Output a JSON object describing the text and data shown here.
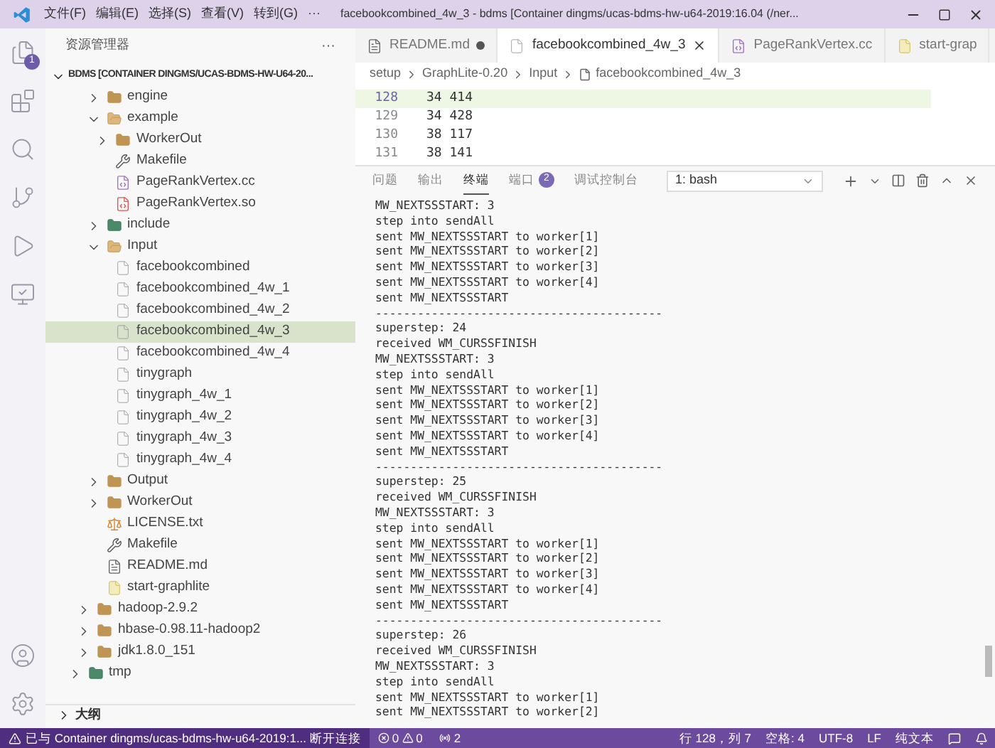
{
  "window": {
    "title": "facebookcombined_4w_3 - bdms [Container dingms/ucas-bdms-hw-u64-2019:16.04 (/ner...",
    "menu": [
      "文件(F)",
      "编辑(E)",
      "选择(S)",
      "查看(V)",
      "转到(G)",
      "···"
    ]
  },
  "activity_bar": {
    "explorer_badge": "1"
  },
  "sidebar": {
    "title": "资源管理器",
    "more": "···",
    "tree": [
      {
        "label": "BDMS [CONTAINER DINGMS/UCAS-BDMS-HW-U64-20...",
        "kind": "root",
        "expanded": true,
        "selected": false,
        "children": [
          {
            "children": [
              {
                "children": [
                  {
                    "label": "engine",
                    "kind": "folder",
                    "expanded": false,
                    "selected": false
                  },
                  {
                    "label": "example",
                    "kind": "folder",
                    "expanded": true,
                    "selected": false,
                    "children": [
                      {
                        "label": "WorkerOut",
                        "kind": "folder",
                        "expanded": false,
                        "selected": false
                      },
                      {
                        "label": "Makefile",
                        "kind": "makefile",
                        "selected": false
                      },
                      {
                        "label": "PageRankVertex.cc",
                        "kind": "cpp",
                        "selected": false
                      },
                      {
                        "label": "PageRankVertex.so",
                        "kind": "binary",
                        "selected": false
                      }
                    ]
                  },
                  {
                    "label": "include",
                    "kind": "special-folder",
                    "expanded": false,
                    "selected": false
                  },
                  {
                    "label": "Input",
                    "kind": "folder",
                    "expanded": true,
                    "selected": false,
                    "children": [
                      {
                        "label": "facebookcombined",
                        "kind": "file",
                        "selected": false
                      },
                      {
                        "label": "facebookcombined_4w_1",
                        "kind": "file",
                        "selected": false
                      },
                      {
                        "label": "facebookcombined_4w_2",
                        "kind": "file",
                        "selected": false
                      },
                      {
                        "label": "facebookcombined_4w_3",
                        "kind": "file",
                        "selected": true
                      },
                      {
                        "label": "facebookcombined_4w_4",
                        "kind": "file",
                        "selected": false
                      },
                      {
                        "label": "tinygraph",
                        "kind": "file",
                        "selected": false
                      },
                      {
                        "label": "tinygraph_4w_1",
                        "kind": "file",
                        "selected": false
                      },
                      {
                        "label": "tinygraph_4w_2",
                        "kind": "file",
                        "selected": false
                      },
                      {
                        "label": "tinygraph_4w_3",
                        "kind": "file",
                        "selected": false
                      },
                      {
                        "label": "tinygraph_4w_4",
                        "kind": "file",
                        "selected": false
                      }
                    ]
                  },
                  {
                    "label": "Output",
                    "kind": "folder",
                    "expanded": false,
                    "selected": false
                  },
                  {
                    "label": "WorkerOut",
                    "kind": "folder",
                    "expanded": false,
                    "selected": false
                  },
                  {
                    "label": "LICENSE.txt",
                    "kind": "license",
                    "selected": false
                  },
                  {
                    "label": "Makefile",
                    "kind": "makefile",
                    "selected": false
                  },
                  {
                    "label": "README.md",
                    "kind": "markdown",
                    "selected": false
                  },
                  {
                    "label": "start-graphlite",
                    "kind": "script",
                    "selected": false
                  }
                ]
              },
              {
                "label": "hadoop-2.9.2",
                "kind": "folder",
                "expanded": false,
                "selected": false
              },
              {
                "label": "hbase-0.98.11-hadoop2",
                "kind": "folder",
                "expanded": false,
                "selected": false
              },
              {
                "label": "jdk1.8.0_151",
                "kind": "folder",
                "expanded": false,
                "selected": false
              }
            ]
          },
          {
            "label": "tmp",
            "kind": "special-folder",
            "expanded": false,
            "selected": false
          }
        ]
      }
    ],
    "outline": {
      "label": "大纲",
      "expanded": false
    }
  },
  "tabs": [
    {
      "label": "README.md",
      "kind": "markdown",
      "selected": false,
      "modified": true
    },
    {
      "label": "facebookcombined_4w_3",
      "kind": "file",
      "selected": true,
      "modified": false
    },
    {
      "label": "PageRankVertex.cc",
      "kind": "cpp",
      "selected": false,
      "modified": false
    },
    {
      "label": "start-grap",
      "kind": "script",
      "selected": false,
      "modified": false
    }
  ],
  "breadcrumb": [
    "setup",
    "GraphLite-0.20",
    "Input",
    "facebookcombined_4w_3"
  ],
  "editor": {
    "lines": [
      {
        "number": "128",
        "text": "34 414",
        "current": true
      },
      {
        "number": "129",
        "text": "34 428",
        "current": false
      },
      {
        "number": "130",
        "text": "38 117",
        "current": false
      },
      {
        "number": "131",
        "text": "38 141",
        "current": false
      }
    ]
  },
  "panel": {
    "tabs": [
      {
        "label": "问题",
        "selected": false
      },
      {
        "label": "输出",
        "selected": false
      },
      {
        "label": "终端",
        "selected": true
      },
      {
        "label": "端口",
        "selected": false,
        "badge": "2"
      },
      {
        "label": "调试控制台",
        "selected": false
      }
    ],
    "terminal_select": "1: bash",
    "terminal": [
      "MW_NEXTSSSTART: 3",
      "step into sendAll",
      "sent MW_NEXTSSSTART to worker[1]",
      "sent MW_NEXTSSSTART to worker[2]",
      "sent MW_NEXTSSSTART to worker[3]",
      "sent MW_NEXTSSSTART to worker[4]",
      "sent MW_NEXTSSSTART",
      "-----------------------------------------",
      "superstep: 24",
      "received WM_CURSSFINISH",
      "MW_NEXTSSSTART: 3",
      "step into sendAll",
      "sent MW_NEXTSSSTART to worker[1]",
      "sent MW_NEXTSSSTART to worker[2]",
      "sent MW_NEXTSSSTART to worker[3]",
      "sent MW_NEXTSSSTART to worker[4]",
      "sent MW_NEXTSSSTART",
      "-----------------------------------------",
      "superstep: 25",
      "received WM_CURSSFINISH",
      "MW_NEXTSSSTART: 3",
      "step into sendAll",
      "sent MW_NEXTSSSTART to worker[1]",
      "sent MW_NEXTSSSTART to worker[2]",
      "sent MW_NEXTSSSTART to worker[3]",
      "sent MW_NEXTSSSTART to worker[4]",
      "sent MW_NEXTSSSTART",
      "-----------------------------------------",
      "superstep: 26",
      "received WM_CURSSFINISH",
      "MW_NEXTSSSTART: 3",
      "step into sendAll",
      "sent MW_NEXTSSSTART to worker[1]",
      "sent MW_NEXTSSSTART to worker[2]"
    ]
  },
  "status_bar": {
    "remote": "已与 Container dingms/ucas-bdms-hw-u64-2019:1... 断开连接",
    "errors": "0",
    "warnings": "0",
    "ports": "2",
    "position": "行 128，列 7",
    "indent": "空格: 4",
    "encoding": "UTF-8",
    "eol": "LF",
    "language": "纯文本"
  }
}
